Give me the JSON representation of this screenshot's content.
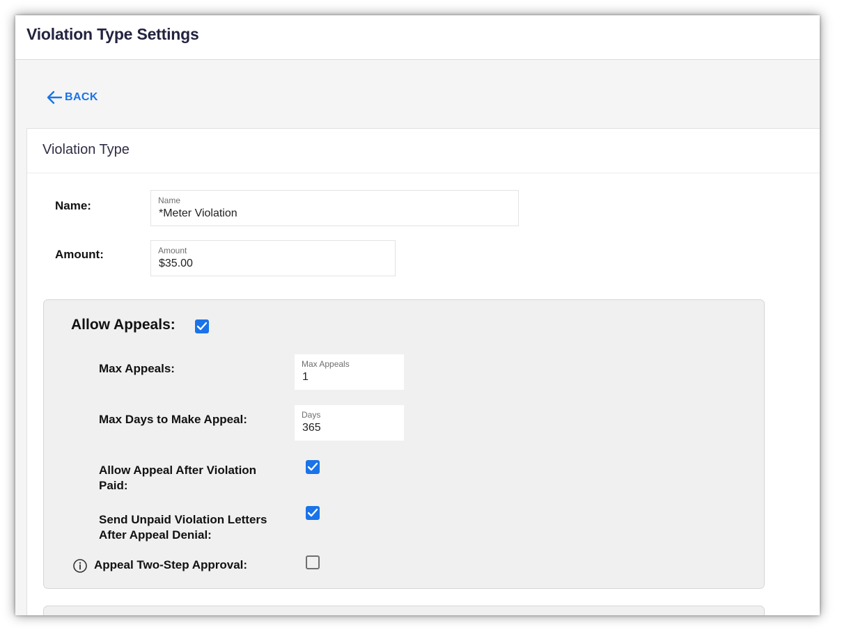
{
  "header": {
    "title": "Violation Type Settings"
  },
  "nav": {
    "back_label": "BACK"
  },
  "card": {
    "title": "Violation Type",
    "name": {
      "label": "Name:",
      "field_label": "Name",
      "value": "*Meter Violation"
    },
    "amount": {
      "label": "Amount:",
      "field_label": "Amount",
      "value": "$35.00"
    }
  },
  "appeals": {
    "heading": "Allow Appeals:",
    "allow_appeals_checked": true,
    "max_appeals": {
      "label": "Max Appeals:",
      "field_label": "Max Appeals",
      "value": "1"
    },
    "max_days": {
      "label": "Max Days to Make Appeal:",
      "field_label": "Days",
      "value": "365"
    },
    "after_paid": {
      "label_line1": "Allow Appeal After Violation",
      "label_line2": "Paid:",
      "checked": true
    },
    "unpaid_letters": {
      "label_line1": "Send Unpaid Violation Letters",
      "label_line2": "After Appeal Denial:",
      "checked": true
    },
    "two_step": {
      "label": "Appeal Two-Step Approval:",
      "checked": false,
      "icon": "info-icon"
    }
  },
  "colors": {
    "accent": "#1a73e8",
    "title": "#23233f",
    "panel_bg": "#f0f0f0"
  }
}
